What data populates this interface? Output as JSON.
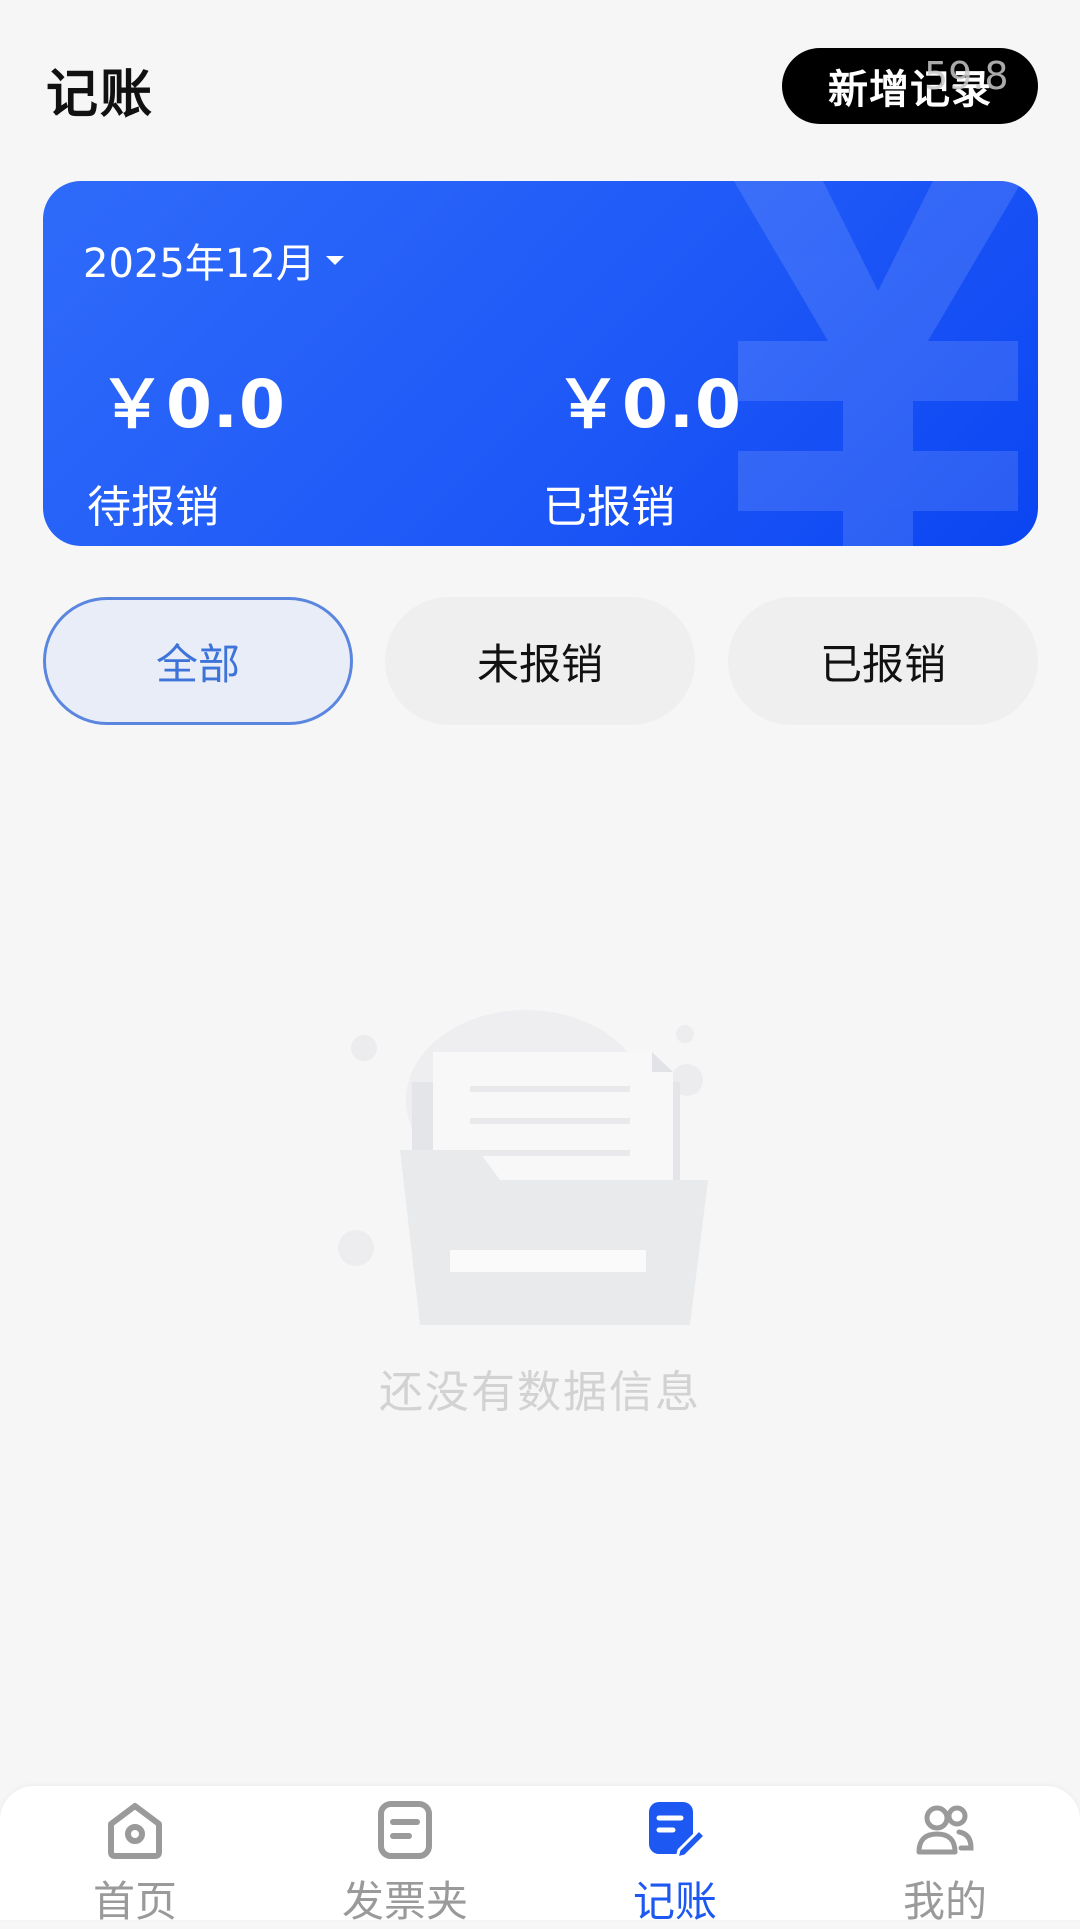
{
  "header": {
    "title": "记账",
    "add_button_label": "新增记录",
    "overlay_timestamp": "59.8"
  },
  "summary": {
    "month": "2025年12月",
    "pending_amount": "￥0.0",
    "pending_label": "待报销",
    "reimbursed_amount": "￥0.0",
    "reimbursed_label": "已报销",
    "card_color": "#1d57f7"
  },
  "filters": {
    "tabs": [
      {
        "label": "全部",
        "active": true
      },
      {
        "label": "未报销",
        "active": false
      },
      {
        "label": "已报销",
        "active": false
      }
    ],
    "active_color": "#3e73d9"
  },
  "empty_state": {
    "icon": "empty-folder-icon",
    "message": "还没有数据信息"
  },
  "bottom_nav": {
    "items": [
      {
        "label": "首页",
        "icon": "home-icon",
        "active": false
      },
      {
        "label": "发票夹",
        "icon": "invoice-folder-icon",
        "active": false
      },
      {
        "label": "记账",
        "icon": "ledger-edit-icon",
        "active": true
      },
      {
        "label": "我的",
        "icon": "user-group-icon",
        "active": false
      }
    ],
    "active_color": "#1d58f2",
    "inactive_color": "#9a9a9a"
  }
}
